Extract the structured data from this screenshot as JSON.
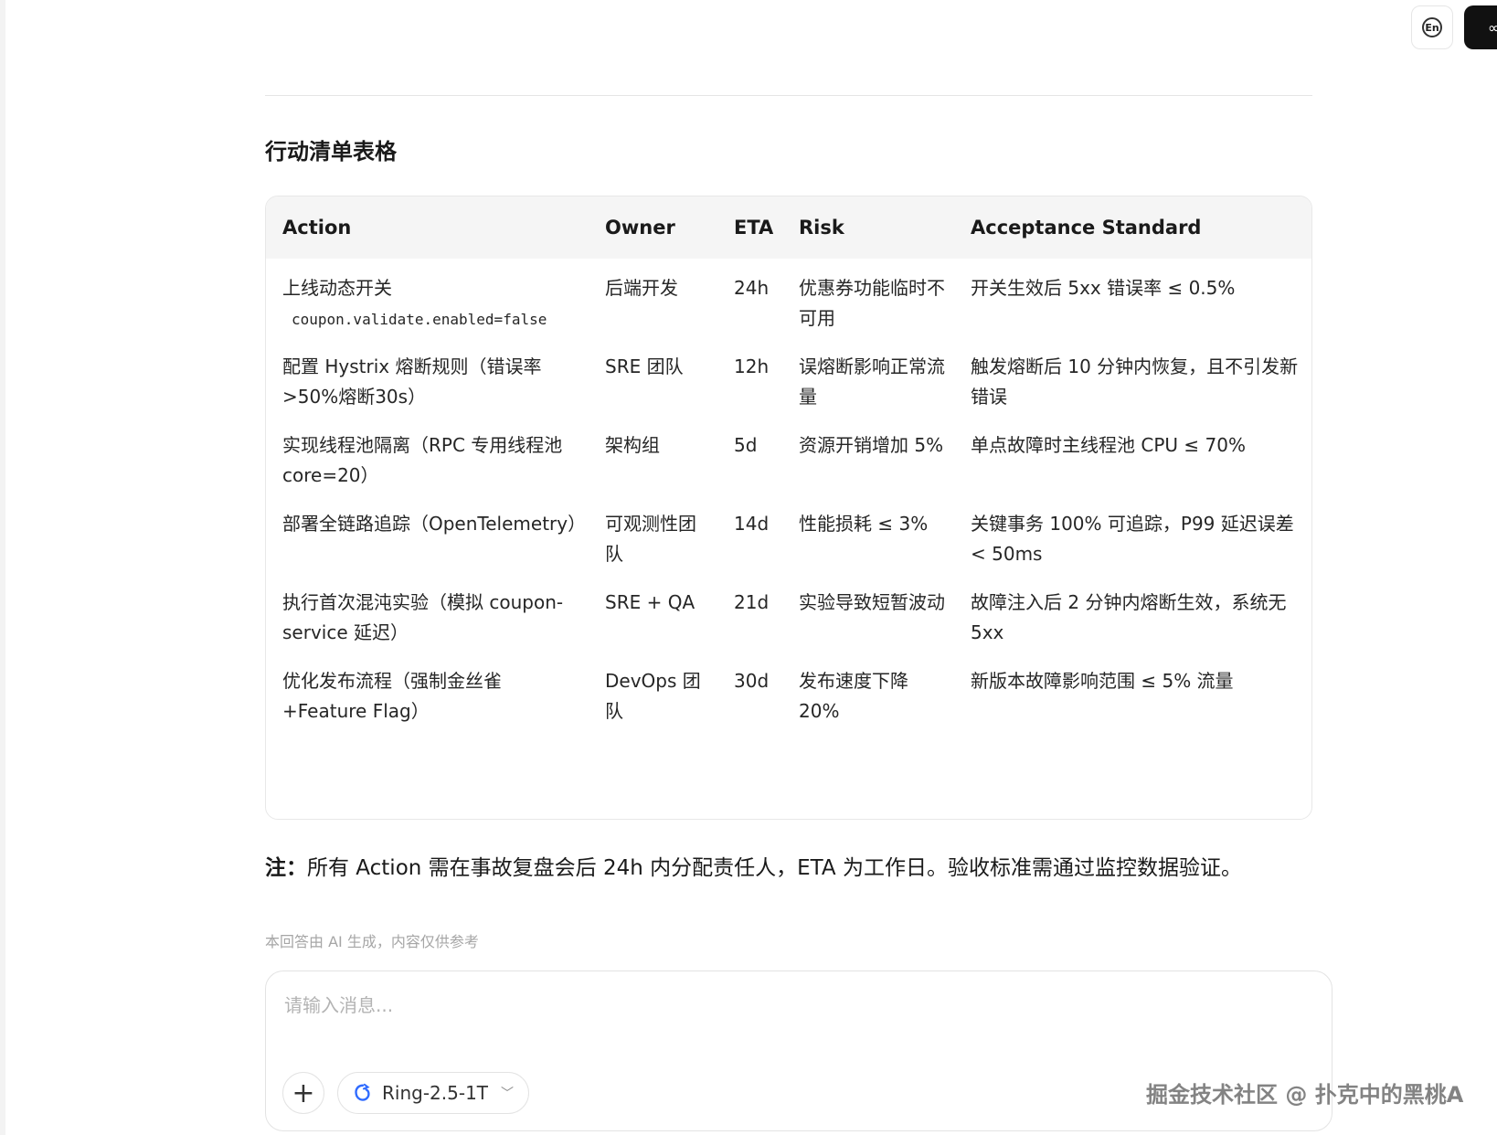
{
  "header": {
    "lang_label": "En"
  },
  "section": {
    "title": "行动清单表格"
  },
  "table": {
    "headers": [
      "Action",
      "Owner",
      "ETA",
      "Risk",
      "Acceptance Standard"
    ],
    "rows": [
      {
        "action": "上线动态开关",
        "code": "coupon.validate.enabled=false",
        "owner": "后端开发",
        "eta": "24h",
        "risk": "优惠券功能临时不可用",
        "acceptance": "开关生效后 5xx 错误率 ≤ 0.5%"
      },
      {
        "action": "配置 Hystrix 熔断规则（错误率>50%熔断30s）",
        "owner": "SRE 团队",
        "eta": "12h",
        "risk": "误熔断影响正常流量",
        "acceptance": "触发熔断后 10 分钟内恢复，且不引发新错误"
      },
      {
        "action": "实现线程池隔离（RPC 专用线程池 core=20）",
        "owner": "架构组",
        "eta": "5d",
        "risk": "资源开销增加 5%",
        "acceptance": "单点故障时主线程池 CPU ≤ 70%"
      },
      {
        "action": "部署全链路追踪（OpenTelemetry）",
        "owner": "可观测性团队",
        "eta": "14d",
        "risk": "性能损耗 ≤ 3%",
        "acceptance": "关键事务 100% 可追踪，P99 延迟误差 < 50ms"
      },
      {
        "action": "执行首次混沌实验（模拟 coupon-service 延迟）",
        "owner": "SRE + QA",
        "eta": "21d",
        "risk": "实验导致短暂波动",
        "acceptance": "故障注入后 2 分钟内熔断生效，系统无 5xx"
      },
      {
        "action": "优化发布流程（强制金丝雀+Feature Flag）",
        "owner": "DevOps 团队",
        "eta": "30d",
        "risk": "发布速度下降 20%",
        "acceptance": "新版本故障影响范围 ≤ 5% 流量"
      }
    ]
  },
  "note": {
    "prefix": "注：",
    "text": "所有 Action 需在事故复盘会后 24h 内分配责任人，ETA 为工作日。验收标准需通过监控数据验证。"
  },
  "disclaimer": "本回答由 AI 生成，内容仅供参考",
  "composer": {
    "placeholder": "请输入消息...",
    "model_name": "Ring-2.5-1T"
  },
  "watermark": "掘金技术社区 @ 扑克中的黑桃A",
  "colors": {
    "header_bg": "#f5f5f5",
    "border": "#e8e8e8",
    "muted_text": "#a6a6a6",
    "model_logo": "#2f6bff"
  }
}
